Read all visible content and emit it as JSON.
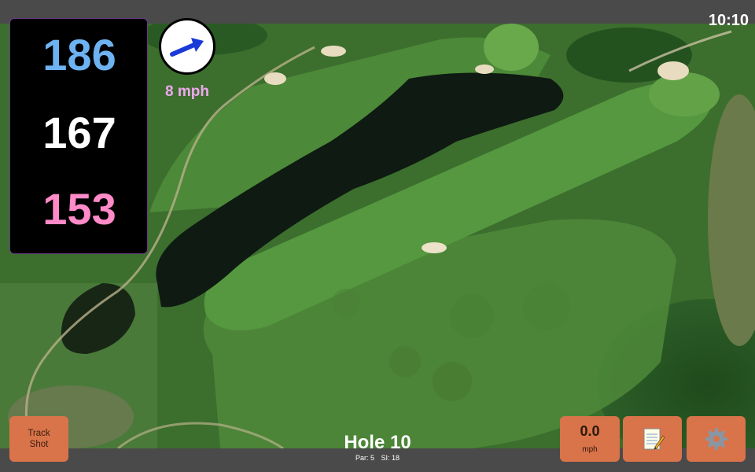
{
  "status": {
    "clock": "10:10"
  },
  "distances": {
    "back": "186",
    "middle": "167",
    "front": "153"
  },
  "wind": {
    "speed": "8 mph",
    "icon": "wind-arrow-icon",
    "arrow_color": "#1a3ad8"
  },
  "buttons": {
    "track_shot": {
      "line1": "Track",
      "line2": "Shot"
    },
    "speed": {
      "value": "0.0",
      "unit": "mph"
    },
    "notes": {
      "icon": "notepad-icon"
    },
    "settings": {
      "icon": "gear-icon"
    }
  },
  "hole": {
    "title": "Hole 10",
    "par": "Par: 5",
    "si": "SI: 18"
  },
  "colors": {
    "back": "#6db3f2",
    "middle": "#ffffff",
    "front": "#ff8ac8",
    "wind_speed": "#f0a8f0",
    "button": "#d9734a",
    "bar": "#4a4a4a"
  }
}
